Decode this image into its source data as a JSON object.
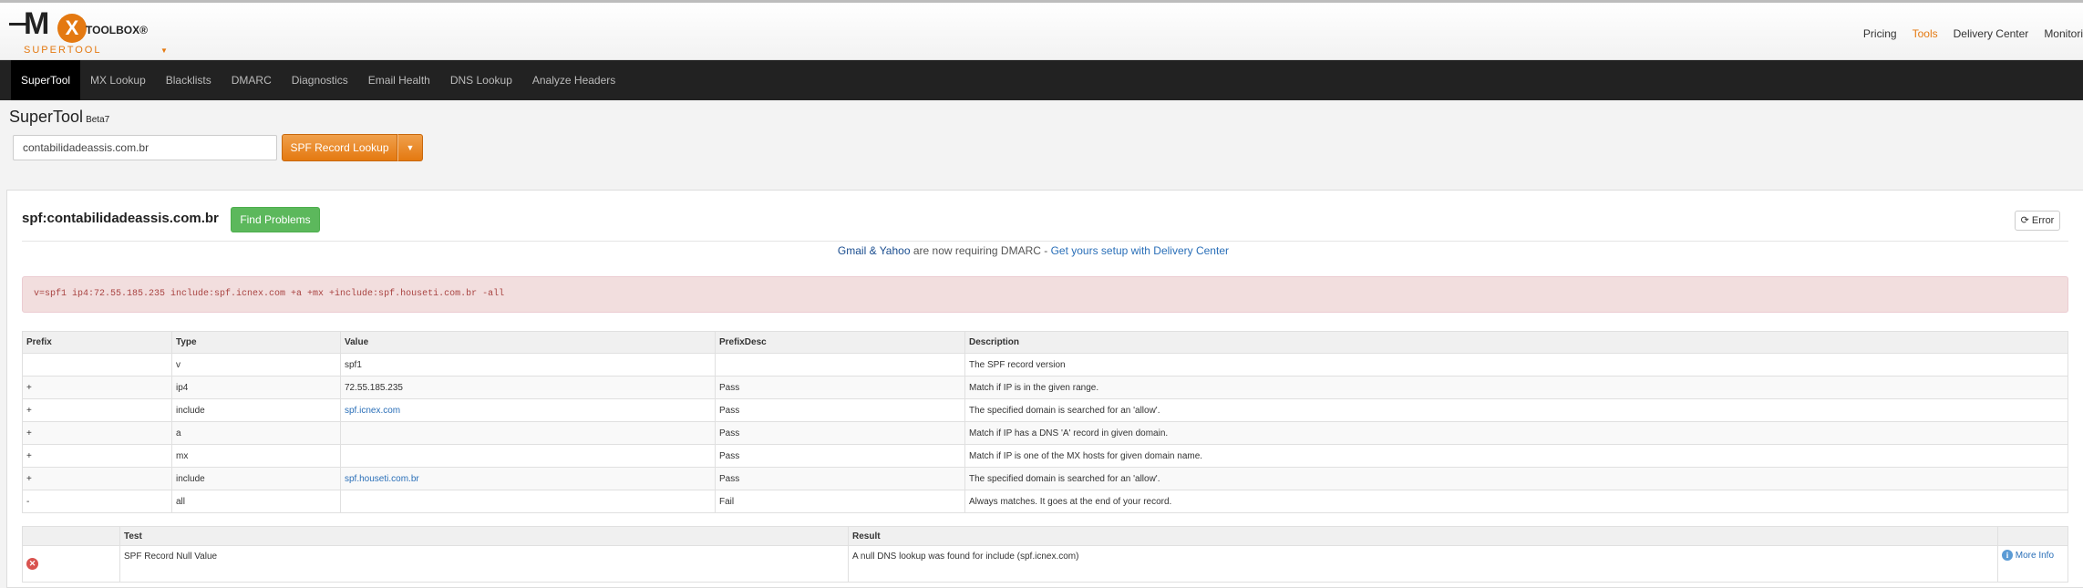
{
  "header": {
    "logo": {
      "brand": "MX TOOLBOX",
      "tm": "®",
      "sub": "SUPERTOOL"
    },
    "topnav": [
      "Pricing",
      "Tools",
      "Delivery Center",
      "Monitori"
    ],
    "active_topnav": "Tools"
  },
  "mainnav": {
    "items": [
      "SuperTool",
      "MX Lookup",
      "Blacklists",
      "DMARC",
      "Diagnostics",
      "Email Health",
      "DNS Lookup",
      "Analyze Headers"
    ]
  },
  "supertool": {
    "title": "SuperTool",
    "beta": "Beta7",
    "input_value": "contabilidadeassis.com.br",
    "lookup_label": "SPF Record Lookup"
  },
  "panel": {
    "title": "spf:contabilidadeassis.com.br",
    "find_problems_label": "Find Problems",
    "error_label": "Error",
    "promo_bold": "Gmail & Yahoo",
    "promo_text": " are now requiring DMARC - ",
    "promo_link": "Get yours setup with Delivery Center",
    "record": "v=spf1 ip4:72.55.185.235 include:spf.icnex.com +a +mx +include:spf.houseti.com.br -all"
  },
  "spf_table": {
    "headers": [
      "Prefix",
      "Type",
      "Value",
      "PrefixDesc",
      "Description"
    ],
    "rows": [
      [
        "",
        "v",
        "spf1",
        "",
        "The SPF record version"
      ],
      [
        "+",
        "ip4",
        "72.55.185.235",
        "Pass",
        "Match if IP is in the given range."
      ],
      [
        "+",
        "include",
        "spf.icnex.com",
        "Pass",
        "The specified domain is searched for an 'allow'."
      ],
      [
        "+",
        "a",
        "",
        "Pass",
        "Match if IP has a DNS 'A' record in given domain."
      ],
      [
        "+",
        "mx",
        "",
        "Pass",
        "Match if IP is one of the MX hosts for given domain name."
      ],
      [
        "+",
        "include",
        "spf.houseti.com.br",
        "Pass",
        "The specified domain is searched for an 'allow'."
      ],
      [
        "-",
        "all",
        "",
        "Fail",
        "Always matches. It goes at the end of your record."
      ]
    ]
  },
  "test_table": {
    "headers": [
      "",
      "Test",
      "Result",
      ""
    ],
    "rows": [
      {
        "test": "SPF Record Null Value",
        "result": "A null DNS lookup was found for include (spf.icnex.com)",
        "more": "More Info"
      }
    ]
  },
  "colors": {
    "accent": "#e47911",
    "nav_bg": "#222222",
    "success": "#5cb85c",
    "alert_bg": "#f2dede",
    "link": "#2a6fb8"
  },
  "icons": [
    "refresh-icon",
    "error-circle-icon",
    "info-circle-icon",
    "caret-down-icon"
  ]
}
